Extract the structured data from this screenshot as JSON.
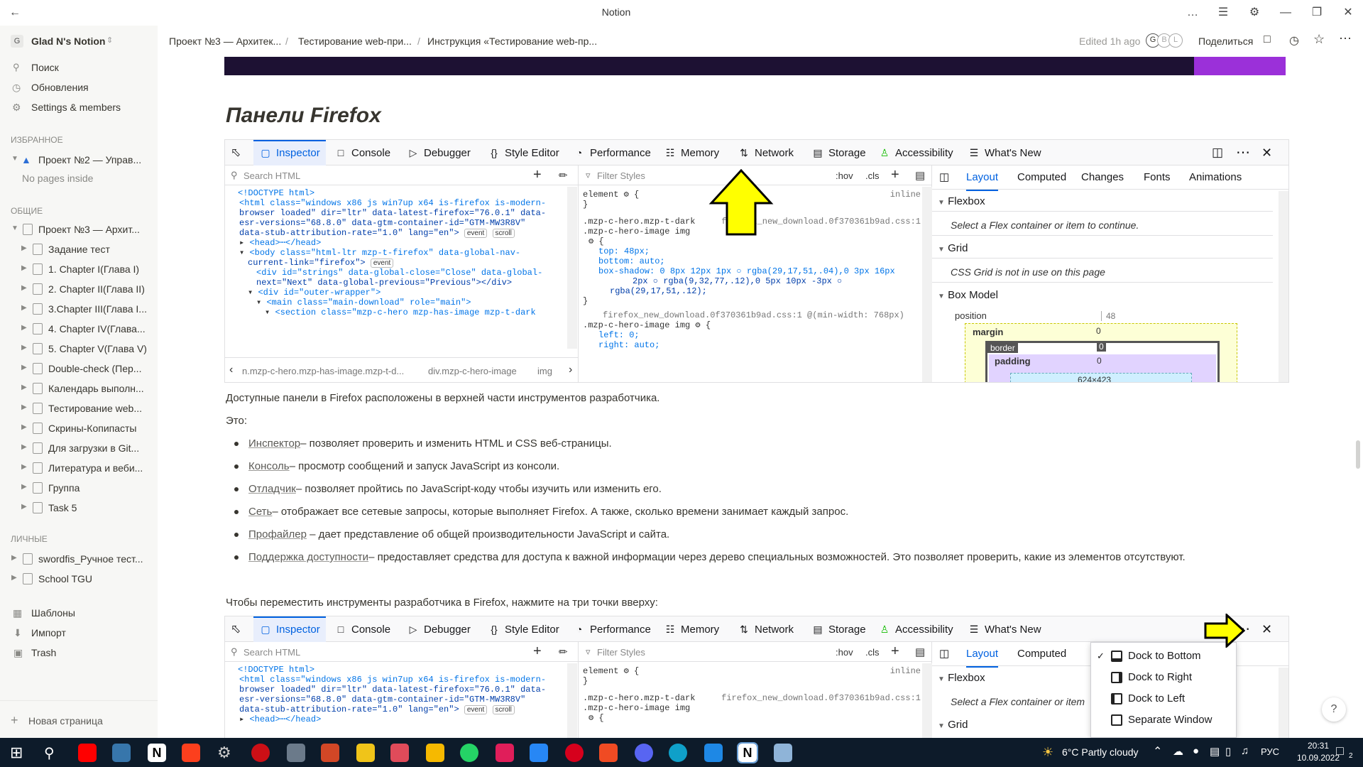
{
  "window": {
    "title": "Notion"
  },
  "sidebar": {
    "workspace": "Glad N's Notion",
    "workspace_initial": "G",
    "top_items": [
      {
        "label": "Поиск",
        "icon": "search-icon"
      },
      {
        "label": "Обновления",
        "icon": "clock-icon"
      },
      {
        "label": "Settings & members",
        "icon": "gear-icon"
      }
    ],
    "favorites_heading": "ИЗБРАННОЕ",
    "favorites": [
      {
        "label": "Проект №2 — Управ..."
      }
    ],
    "no_pages": "No pages inside",
    "shared_heading": "ОБЩИЕ",
    "shared_root": "Проект №3 — Архит...",
    "shared_children": [
      "Задание тест",
      "1. Chapter I(Глава I)",
      "2. Chapter II(Глава II)",
      "3.Chapter III(Глава I...",
      "4. Chapter IV(Глава...",
      "5. Chapter V(Глава V)",
      "Double-check (Пер...",
      "Календарь выполн...",
      "Тестирование web...",
      "Скрины-Копипасты",
      "Для загрузки в Git...",
      "Литература и веби...",
      "Группа",
      "Task 5"
    ],
    "private_heading": "ЛИЧНЫЕ",
    "private": [
      "swordfis_Ручное тест...",
      "School TGU"
    ],
    "bottom_items": [
      {
        "label": "Шаблоны",
        "icon": "templates-icon"
      },
      {
        "label": "Импорт",
        "icon": "import-icon"
      },
      {
        "label": "Trash",
        "icon": "trash-icon"
      }
    ],
    "new_page": "Новая страница"
  },
  "topbar": {
    "breadcrumbs": [
      "Проект №3 — Архитек...",
      "Тестирование web-при...",
      "Инструкция «Тестирование web-пр..."
    ],
    "edited": "Edited 1h ago",
    "avatars": [
      "G",
      "B",
      "L"
    ],
    "share": "Поделиться"
  },
  "page": {
    "heading": "Панели Firefox",
    "p1": "Доступные панели в Firefox расположены в верхней части инструментов разработчика.",
    "p2": "Это:",
    "bullets": [
      {
        "link": "Инспектор",
        "text": "– позволяет проверить и изменить HTML и CSS веб-страницы."
      },
      {
        "link": "Консоль",
        "text": "– просмотр сообщений и запуск JavaScript из консоли."
      },
      {
        "link": "Отладчик",
        "text": "– позволяет пройтись по JavaScript-коду чтобы изучить или изменить его."
      },
      {
        "link": "Сеть",
        "text": "– отображает все сетевые запросы, которые выполняет Firefox. А также, сколько времени занимает каждый запрос."
      },
      {
        "link": "Профайлер",
        "text": " – дает представление об общей производительности JavaScript и сайта."
      },
      {
        "link": "Поддержка доступности",
        "text": "– предоставляет средства для доступа к важной информации через дерево специальных возможностей. Это позволяет проверить, какие из элементов отсутствуют."
      }
    ],
    "p3": "Чтобы переместить инструменты разработчика в Firefox, нажмите на три точки вверху:",
    "help": "?"
  },
  "devtools": {
    "tabs": [
      "Inspector",
      "Console",
      "Debugger",
      "Style Editor",
      "Performance",
      "Memory",
      "Network",
      "Storage",
      "Accessibility",
      "What's New"
    ],
    "search_html": "Search HTML",
    "filter_styles": "Filter Styles",
    "hov": ":hov",
    "cls": ".cls",
    "side_tabs": [
      "Layout",
      "Computed",
      "Changes",
      "Fonts",
      "Animations"
    ],
    "flexbox": "Flexbox",
    "flex_hint": "Select a Flex container or item to continue.",
    "flex_hint_short": "Select a Flex container or item",
    "grid": "Grid",
    "grid_hint": "CSS Grid is not in use on this page",
    "boxmodel": "Box Model",
    "position": "position",
    "position_val": "48",
    "margin": "margin",
    "border": "border",
    "padding": "padding",
    "zero": "0",
    "content_size": "624×423",
    "breadcrumb": [
      "n.mzp-c-hero.mzp-has-image.mzp-t-d...",
      "div.mzp-c-hero-image",
      "img"
    ],
    "html_lines": [
      "<!DOCTYPE html>",
      "<html class=\"windows x86 js win7up x64 is-firefox is-modern-",
      "browser loaded\" dir=\"ltr\" data-latest-firefox=\"76.0.1\" data-",
      "esr-versions=\"68.8.0\" data-gtm-container-id=\"GTM-MW3R8V\"",
      "data-stub-attribution-rate=\"1.0\" lang=\"en\">",
      "<head>⋯</head>",
      "<body class=\"html-ltr mzp-t-firefox\" data-global-nav-",
      "current-link=\"firefox\">",
      "<div id=\"strings\" data-global-close=\"Close\" data-global-",
      "next=\"Next\" data-global-previous=\"Previous\"></div>",
      "<div id=\"outer-wrapper\">",
      "<main class=\"main-download\" role=\"main\">",
      "<section class=\"mzp-c-hero mzp-has-image mzp-t-dark"
    ],
    "badges": {
      "event": "event",
      "scroll": "scroll"
    },
    "css_lines": [
      "element ⚙ {",
      "}",
      ".mzp-c-hero.mzp-t-dark",
      ".mzp-c-hero-image img",
      "⚙ {",
      "top: 48px;",
      "bottom: auto;",
      "box-shadow: 0 8px 12px 1px ○ rgba(29,17,51,.04),0 3px 16px",
      "2px ○ rgba(9,32,77,.12),0 5px 10px -3px ○",
      "rgba(29,17,51,.12);",
      "}",
      "firefox_new_download.0f370361b9ad.css:1 @(min-width: 768px)",
      ".mzp-c-hero-image img ⚙ {",
      "left: 0;",
      "right: auto;"
    ],
    "inline": "inline",
    "css_source": "firefox_new_download.0f370361b9ad.css:1"
  },
  "dock_menu": {
    "items": [
      "Dock to Bottom",
      "Dock to Right",
      "Dock to Left",
      "Separate Window"
    ],
    "checked_index": 0
  },
  "taskbar": {
    "weather": "6°C  Partly cloudy",
    "lang": "РУС",
    "time": "20:31",
    "date": "10.09.2022",
    "notif_count": "2"
  },
  "colors": {
    "accent": "#0061e0",
    "arrow": "#ffff00",
    "taskbar": "#0d1b2a"
  }
}
